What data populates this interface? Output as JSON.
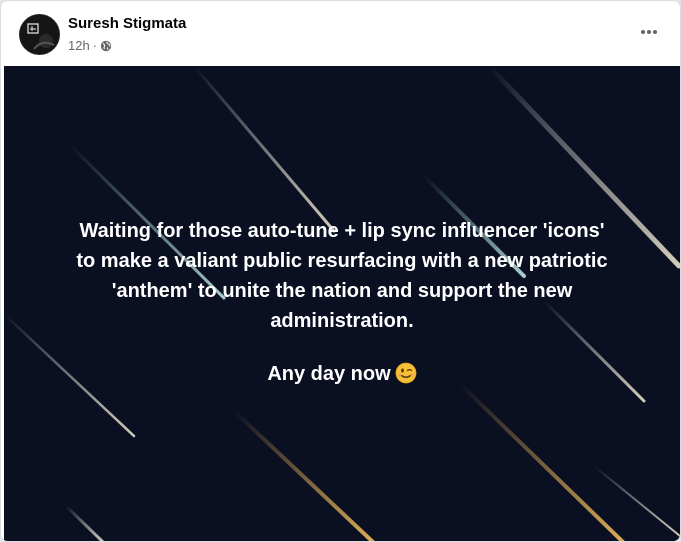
{
  "post": {
    "author": "Suresh Stigmata",
    "time": "12h",
    "separator": "·",
    "privacy_icon": "globe-icon",
    "more_icon": "more-horizontal-icon",
    "lines": [
      "Waiting for those auto-tune + lip sync influencer 'icons'",
      "to make a valiant public resurfacing with a new patriotic",
      "'anthem' to unite the nation and support the new",
      "administration."
    ],
    "closing": "Any day now",
    "closing_emoji": "winking-face-emoji",
    "background_color": "#0b0f22",
    "text_color": "#ffffff"
  }
}
